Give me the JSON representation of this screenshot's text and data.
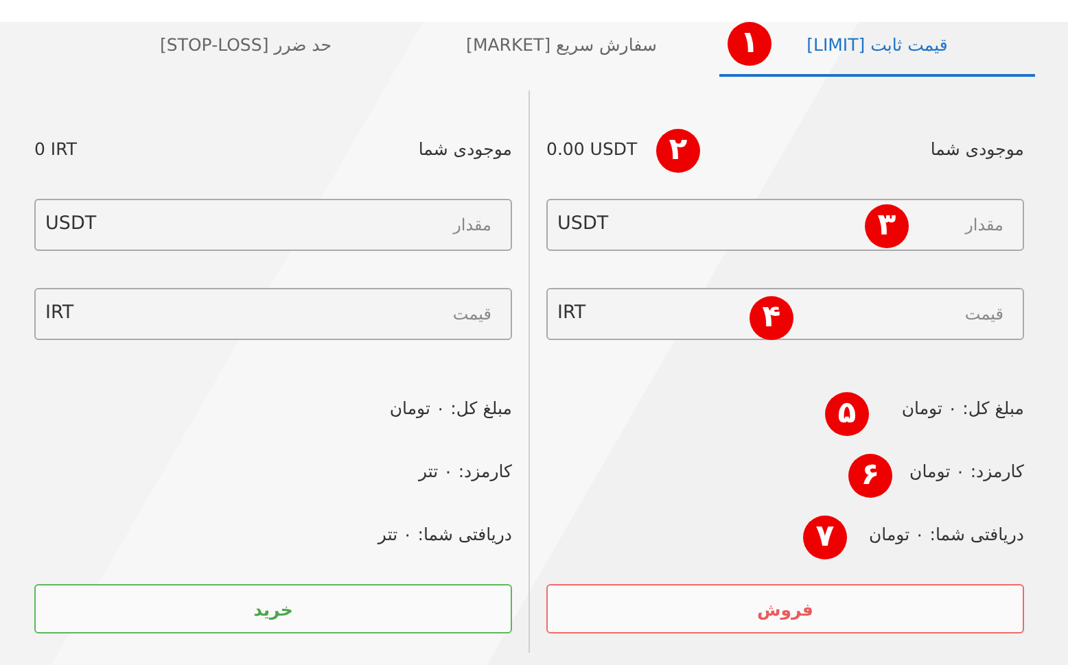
{
  "tabs": [
    {
      "label": "قیمت ثابت [LIMIT]",
      "selected": true
    },
    {
      "label": "سفارش سریع [MARKET]",
      "selected": false
    },
    {
      "label": "حد ضرر [STOP-LOSS]",
      "selected": false
    }
  ],
  "panels": [
    {
      "balance_label": "موجودی شما",
      "balance": "0.00 USDT",
      "fields": [
        {
          "placeholder": "مقدار",
          "unit": "USDT"
        },
        {
          "placeholder": "قیمت",
          "unit": "IRT"
        }
      ],
      "summary": [
        "مبلغ کل: ۰ تومان",
        "کارمزد: ۰ تومان",
        "دریافتی شما: ۰ تومان"
      ],
      "button": {
        "label": "فروش",
        "kind": "sell"
      }
    },
    {
      "balance_label": "موجودی شما",
      "balance": "0 IRT",
      "fields": [
        {
          "placeholder": "مقدار",
          "unit": "USDT"
        },
        {
          "placeholder": "قیمت",
          "unit": "IRT"
        }
      ],
      "summary": [
        "مبلغ کل: ۰ تومان",
        "کارمزد: ۰ تتر",
        "دریافتی شما: ۰ تتر"
      ],
      "button": {
        "label": "خرید",
        "kind": "buy"
      }
    }
  ],
  "callouts": [
    {
      "label": "۱"
    },
    {
      "label": "۲"
    },
    {
      "label": "۳"
    },
    {
      "label": "۴"
    },
    {
      "label": "۵"
    },
    {
      "label": "۶"
    },
    {
      "label": "۷"
    }
  ]
}
